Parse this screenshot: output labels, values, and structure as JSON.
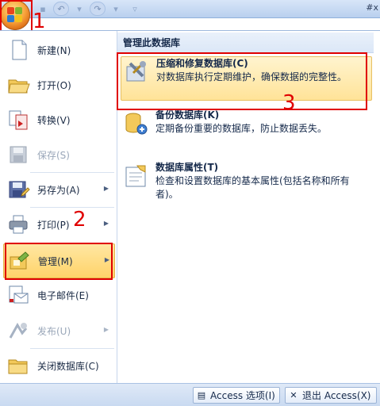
{
  "window": {
    "title_partial": "#x"
  },
  "annotations": {
    "orb_number": "1",
    "manage_number": "2",
    "compact_number": "3",
    "color": "#e00000"
  },
  "left_menu": {
    "items": [
      {
        "label": "新建(N)",
        "icon": "new-document-icon"
      },
      {
        "label": "打开(O)",
        "icon": "open-folder-icon"
      },
      {
        "label": "转换(V)",
        "icon": "convert-icon"
      },
      {
        "label": "保存(S)",
        "icon": "save-disk-icon",
        "disabled": true
      },
      {
        "label": "另存为(A)",
        "icon": "save-as-icon",
        "submenu": true
      },
      {
        "label": "打印(P)",
        "icon": "printer-icon",
        "submenu": true
      },
      {
        "label": "管理(M)",
        "icon": "manage-icon",
        "submenu": true,
        "active": true
      },
      {
        "label": "电子邮件(E)",
        "icon": "email-icon"
      },
      {
        "label": "发布(U)",
        "icon": "publish-icon",
        "submenu": true,
        "disabled": true
      },
      {
        "label": "关闭数据库(C)",
        "icon": "close-database-icon"
      }
    ]
  },
  "submenu": {
    "header": "管理此数据库",
    "items": [
      {
        "title": "压缩和修复数据库(C)",
        "desc": "对数据库执行定期维护，确保数据的完整性。",
        "icon": "compact-repair-icon"
      },
      {
        "title": "备份数据库(K)",
        "desc": "定期备份重要的数据库，防止数据丢失。",
        "icon": "backup-database-icon"
      },
      {
        "title": "数据库属性(T)",
        "desc": "检查和设置数据库的基本属性(包括名称和所有者)。",
        "icon": "database-properties-icon"
      }
    ]
  },
  "bottom": {
    "options_label": "Access 选项(I)",
    "exit_label": "退出 Access(X)"
  }
}
